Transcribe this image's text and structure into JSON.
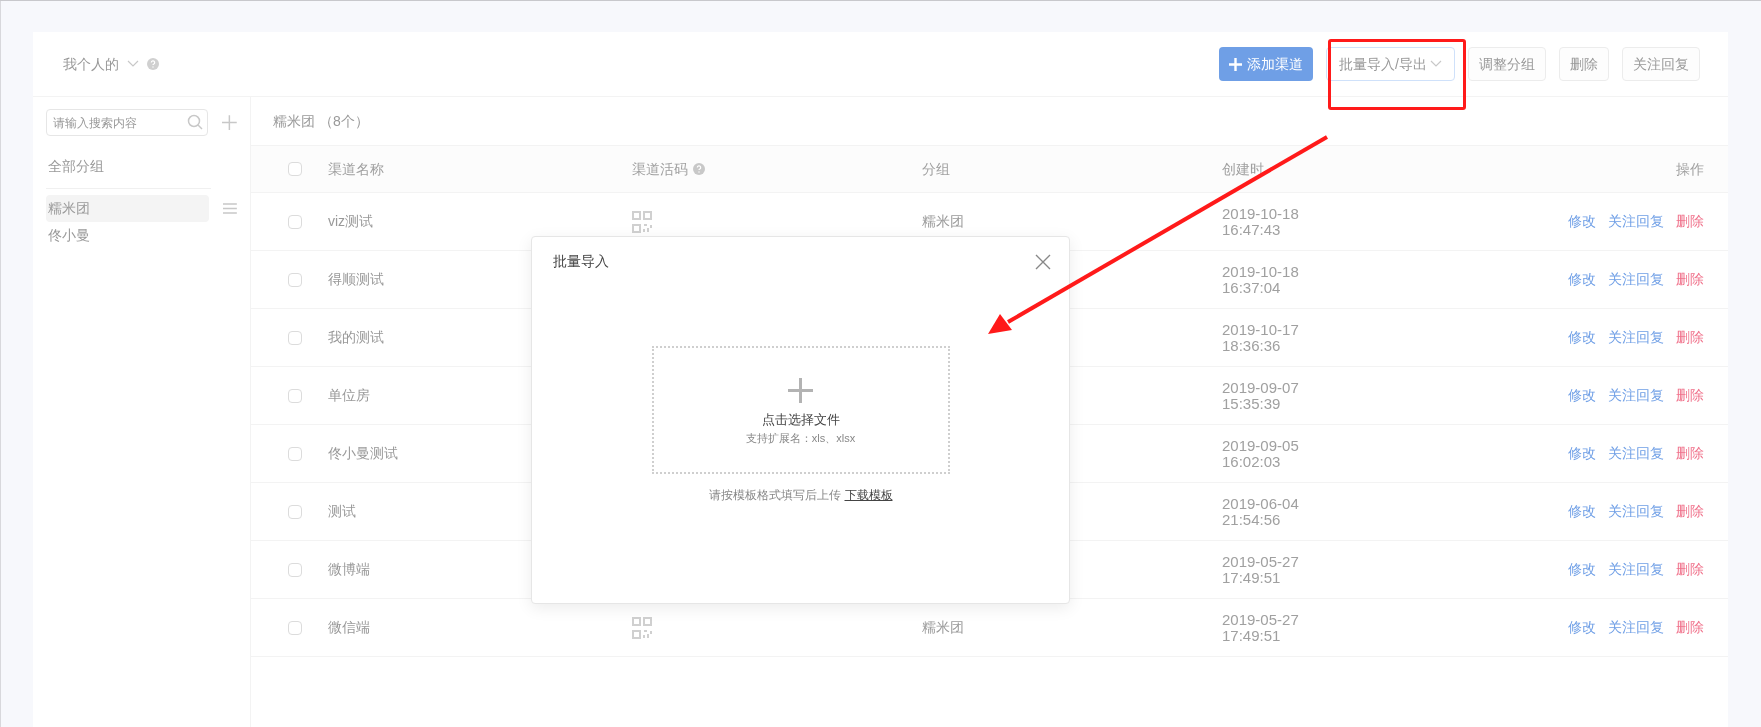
{
  "header": {
    "scope": "我个人的",
    "buttons": [
      {
        "label": "添加渠道",
        "kind": "primary"
      },
      {
        "label": "批量导入/导出",
        "kind": "dropdown"
      },
      {
        "label": "调整分组",
        "kind": "default"
      },
      {
        "label": "删除",
        "kind": "default"
      },
      {
        "label": "关注回复",
        "kind": "default"
      }
    ]
  },
  "sidebar": {
    "search": {
      "placeholder": "请输入搜索内容"
    },
    "all_groups": "全部分组",
    "groups": [
      {
        "label": "糯米团",
        "selected": true
      },
      {
        "label": "佟小曼",
        "selected": false
      }
    ]
  },
  "table": {
    "title": "糯米团",
    "count": "（8个）",
    "select_all_checked": false,
    "columns": [
      "渠道名称",
      "渠道活码",
      "分组",
      "创建时",
      "操作"
    ],
    "rows": [
      {
        "name": "viz测试",
        "checked": false,
        "qr": true,
        "group": "糯米团",
        "date": "2019-10-18",
        "time": "16:47:43",
        "actions": [
          {
            "label": "修改",
            "kind": "link"
          },
          {
            "label": "关注回复",
            "kind": "link"
          },
          {
            "label": "删除",
            "kind": "danger"
          }
        ]
      },
      {
        "name": "得顺测试",
        "checked": false,
        "qr": false,
        "date": "2019-10-18",
        "time": "16:37:04",
        "actions": [
          {
            "label": "修改",
            "kind": "link"
          },
          {
            "label": "关注回复",
            "kind": "link"
          },
          {
            "label": "删除",
            "kind": "danger"
          }
        ]
      },
      {
        "name": "我的测试",
        "checked": false,
        "qr": false,
        "date": "2019-10-17",
        "time": "18:36:36",
        "actions": [
          {
            "label": "修改",
            "kind": "link"
          },
          {
            "label": "关注回复",
            "kind": "link"
          },
          {
            "label": "删除",
            "kind": "danger"
          }
        ]
      },
      {
        "name": "单位房",
        "checked": false,
        "qr": false,
        "date": "2019-09-07",
        "time": "15:35:39",
        "actions": [
          {
            "label": "修改",
            "kind": "link"
          },
          {
            "label": "关注回复",
            "kind": "link"
          },
          {
            "label": "删除",
            "kind": "danger"
          }
        ]
      },
      {
        "name": "佟小曼测试",
        "checked": false,
        "qr": false,
        "date": "2019-09-05",
        "time": "16:02:03",
        "actions": [
          {
            "label": "修改",
            "kind": "link"
          },
          {
            "label": "关注回复",
            "kind": "link"
          },
          {
            "label": "删除",
            "kind": "danger"
          }
        ]
      },
      {
        "name": "测试",
        "checked": false,
        "qr": false,
        "date": "2019-06-04",
        "time": "21:54:56",
        "actions": [
          {
            "label": "修改",
            "kind": "link"
          },
          {
            "label": "关注回复",
            "kind": "link"
          },
          {
            "label": "删除",
            "kind": "danger"
          }
        ]
      },
      {
        "name": "微博端",
        "checked": false,
        "qr": false,
        "date": "2019-05-27",
        "time": "17:49:51",
        "actions": [
          {
            "label": "修改",
            "kind": "link"
          },
          {
            "label": "关注回复",
            "kind": "link"
          },
          {
            "label": "删除",
            "kind": "danger"
          }
        ]
      },
      {
        "name": "微信端",
        "checked": false,
        "qr": true,
        "group": "糯米团",
        "date": "2019-05-27",
        "time": "17:49:51",
        "actions": [
          {
            "label": "修改",
            "kind": "link"
          },
          {
            "label": "关注回复",
            "kind": "link"
          },
          {
            "label": "删除",
            "kind": "danger"
          }
        ]
      }
    ]
  },
  "modal": {
    "title": "批量导入",
    "upload_label": "点击选择文件",
    "upload_hint": "支持扩展名：xls、xlsx",
    "note": "请按模板格式填写后上传",
    "template_link": "下载模板"
  }
}
